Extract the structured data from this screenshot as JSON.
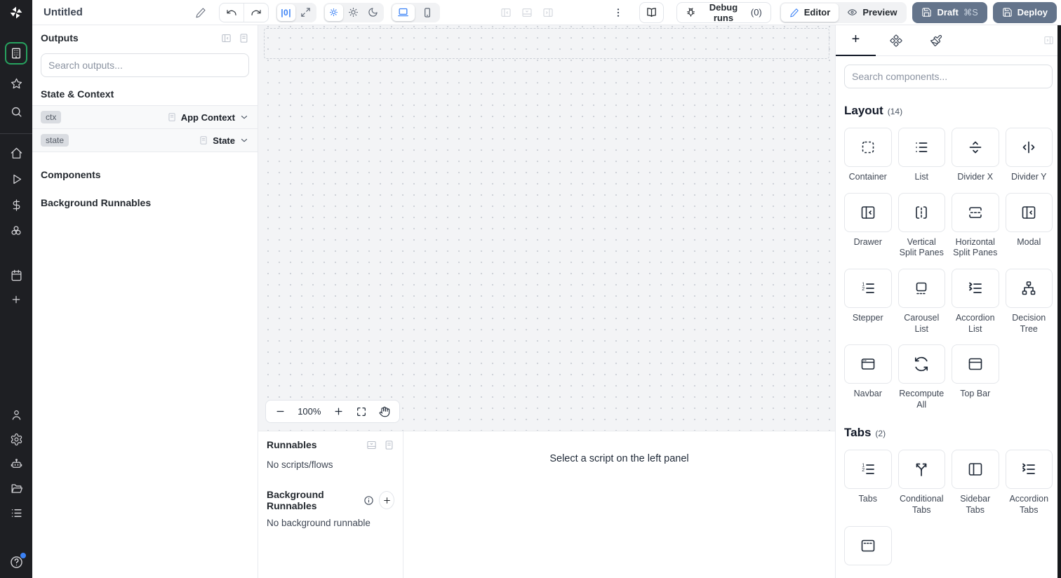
{
  "topbar": {
    "title": "Untitled",
    "zoom_fit_label": "|0|",
    "debug_runs": "Debug runs",
    "debug_count": "(0)",
    "editor": "Editor",
    "preview": "Preview",
    "draft": "Draft",
    "draft_shortcut": "⌘S",
    "deploy": "Deploy"
  },
  "outputs": {
    "title": "Outputs",
    "search_placeholder": "Search outputs...",
    "state_context_header": "State & Context",
    "components_header": "Components",
    "background_header": "Background Runnables",
    "rows": [
      {
        "badge": "ctx",
        "type": "App Context"
      },
      {
        "badge": "state",
        "type": "State"
      }
    ]
  },
  "canvas": {
    "zoom_level": "100%"
  },
  "runnables": {
    "title": "Runnables",
    "no_scripts": "No scripts/flows",
    "background_title": "Background Runnables",
    "no_background": "No background runnable",
    "hint": "Select a script on the left panel"
  },
  "components": {
    "search_placeholder": "Search components...",
    "layout_title": "Layout",
    "layout_count": "(14)",
    "tabs_title": "Tabs",
    "tabs_count": "(2)",
    "layout_items": [
      "Container",
      "List",
      "Divider X",
      "Divider Y",
      "Drawer",
      "Vertical Split Panes",
      "Horizontal Split Panes",
      "Modal",
      "Stepper",
      "Carousel List",
      "Accordion List",
      "Decision Tree",
      "Navbar",
      "Recompute All",
      "Top Bar"
    ],
    "tabs_items": [
      "Tabs",
      "Conditional Tabs",
      "Sidebar Tabs",
      "Accordion Tabs"
    ]
  },
  "icons": {
    "add_tab": "+",
    "zoom_out": "−",
    "zoom_in": "+"
  },
  "colors": {
    "accent_blue": "#3b82f6",
    "active_green": "#27a25f",
    "slate_button": "#64748b",
    "sidebar_bg": "#1e1f23",
    "canvas_bg": "#f3f4f6",
    "border": "#e8eaee"
  }
}
